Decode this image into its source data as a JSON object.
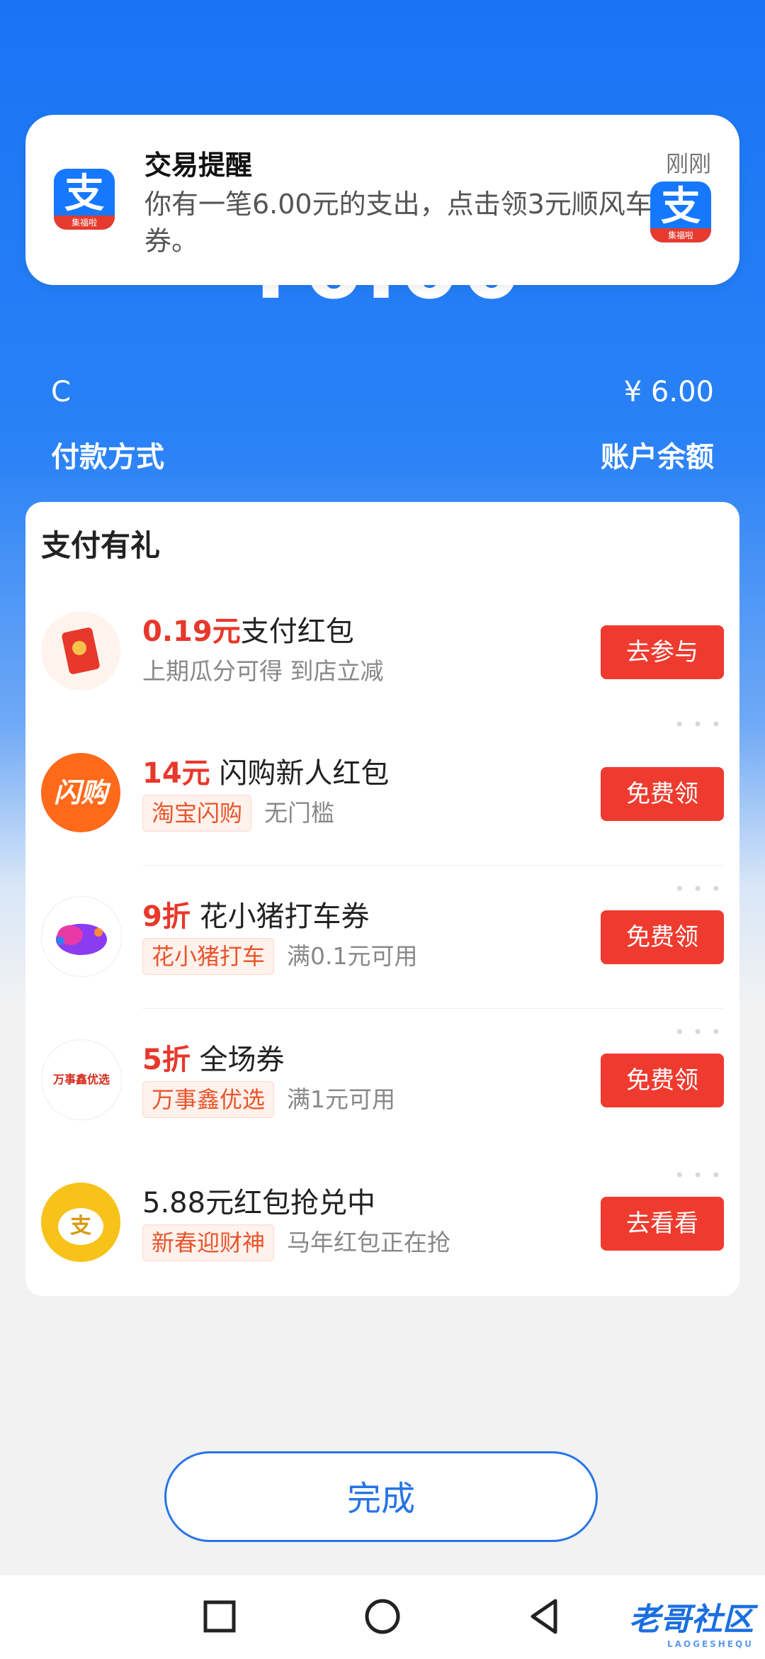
{
  "notification": {
    "title": "交易提醒",
    "time": "刚刚",
    "body": "你有一笔6.00元的支出，点击领3元顺风车券。",
    "app_icon_glyph": "支",
    "app_icon_band": "集福啦"
  },
  "amount_peek": "¥6.00",
  "payment": {
    "method_value": "C",
    "amount_value": "¥ 6.00",
    "method_label": "付款方式",
    "amount_label": "账户余额"
  },
  "rewards": {
    "title": "支付有礼",
    "items": [
      {
        "highlight": "0.19元",
        "title": "支付红包",
        "tag": "",
        "note": "上期瓜分可得 到店立减",
        "button": "去参与",
        "icon": "red-envelope-icon"
      },
      {
        "highlight": "14元",
        "title": " 闪购新人红包",
        "tag": "淘宝闪购",
        "note": "无门槛",
        "button": "免费领",
        "icon": "shangou-logo",
        "logo_text": "闪购"
      },
      {
        "highlight": "9折",
        "title": " 花小猪打车券",
        "tag": "花小猪打车",
        "note": "满0.1元可用",
        "button": "免费领",
        "icon": "huaxiaozhu-pig-logo"
      },
      {
        "highlight": "5折",
        "title": " 全场券",
        "tag": "万事鑫优选",
        "note": "满1元可用",
        "button": "免费领",
        "icon": "wanshixin-logo",
        "logo_text": "万事鑫优选"
      },
      {
        "highlight": "",
        "title": "5.88元红包抢兑中",
        "tag": "新春迎财神",
        "note": "马年红包正在抢",
        "button": "去看看",
        "icon": "fortune-bag-icon",
        "logo_text": "支"
      }
    ]
  },
  "done_button": "完成",
  "watermark": {
    "text": "老哥社区",
    "sub": "LAOGESHEQU"
  },
  "colors": {
    "brand_blue": "#1874f5",
    "accent_red": "#ef3b2f",
    "tag_orange": "#e8552b"
  }
}
